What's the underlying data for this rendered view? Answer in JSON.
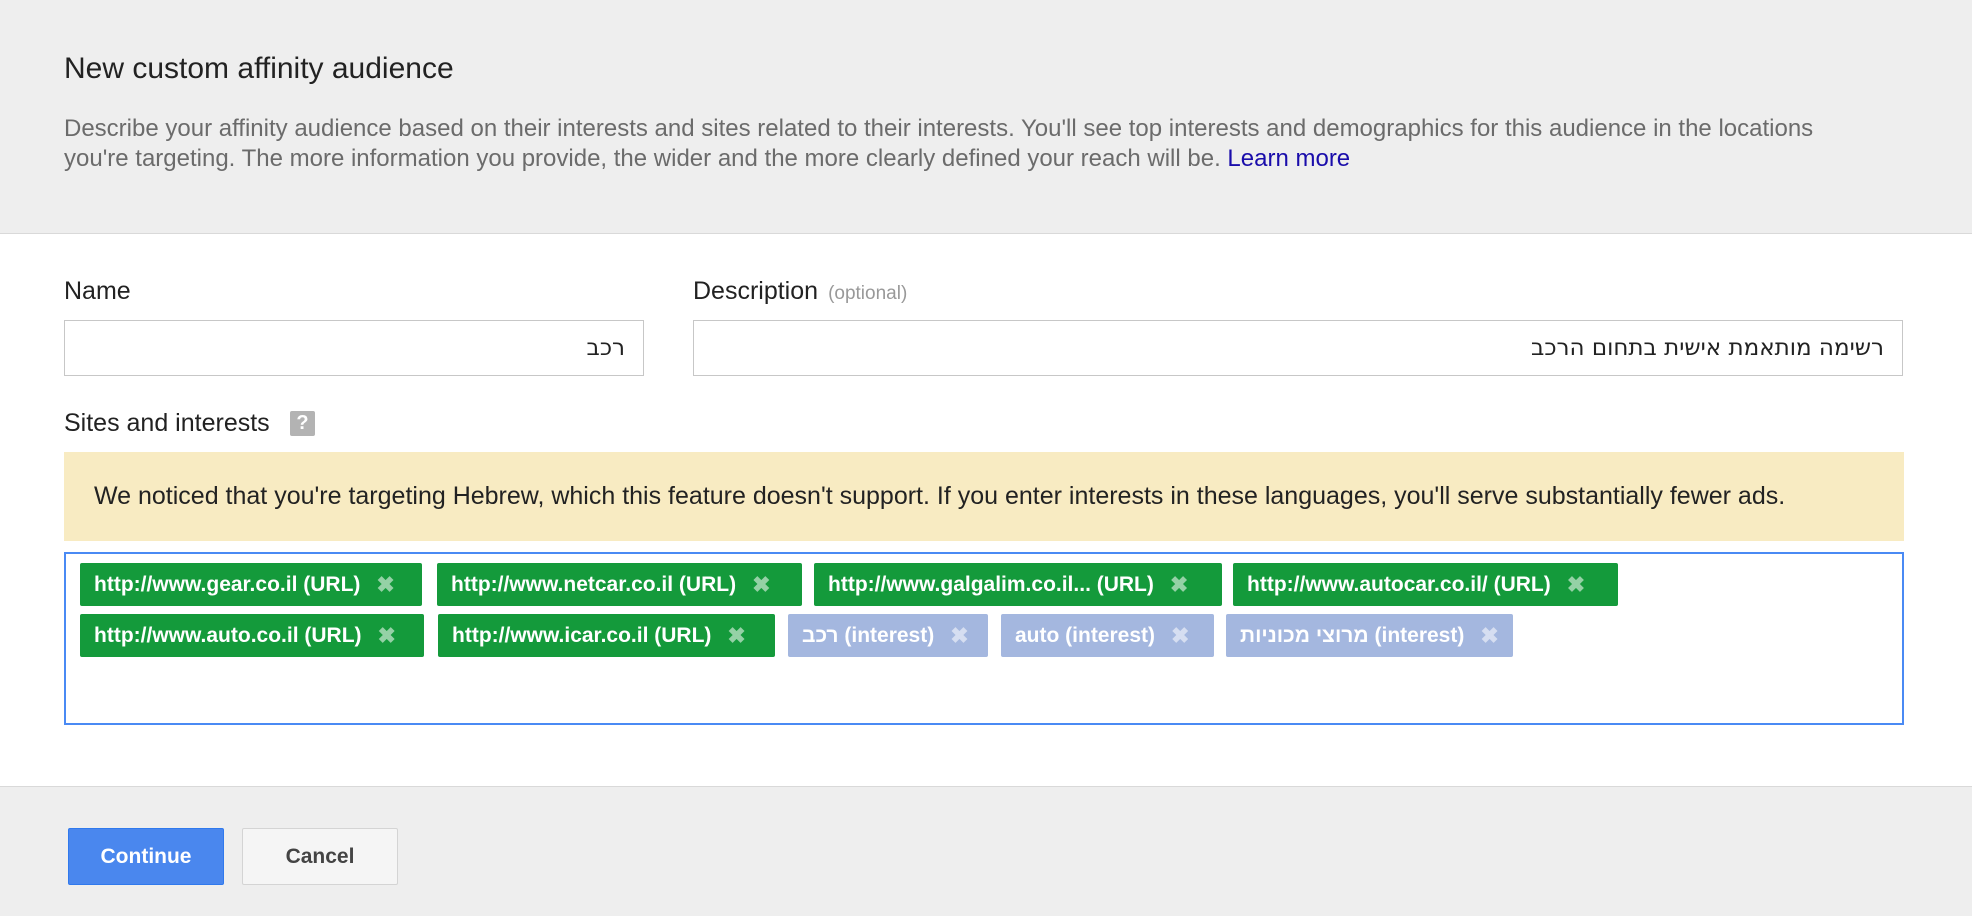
{
  "header": {
    "title": "New custom affinity audience",
    "description": "Describe your affinity audience based on their interests and sites related to their interests. You'll see top interests and demographics for this audience in the locations you're targeting. The more information you provide, the wider and the more clearly defined your reach will be.",
    "learn_more": "Learn more"
  },
  "form": {
    "name_label": "Name",
    "name_value": "רכב",
    "description_label": "Description",
    "description_optional": "(optional)",
    "description_value": "רשימה מותאמת אישית בתחום הרכב",
    "sites_label": "Sites and interests",
    "help_glyph": "?"
  },
  "warning": "We noticed that you're targeting Hebrew, which this feature doesn't support. If you enter interests in these languages, you'll serve substantially fewer ads.",
  "tags": [
    {
      "label": "http://www.gear.co.il (URL)",
      "kind": "url"
    },
    {
      "label": "http://www.netcar.co.il (URL)",
      "kind": "url"
    },
    {
      "label": "http://www.galgalim.co.il... (URL)",
      "kind": "url"
    },
    {
      "label": "http://www.autocar.co.il/ (URL)",
      "kind": "url"
    },
    {
      "label": "http://www.auto.co.il (URL)",
      "kind": "url"
    },
    {
      "label": "http://www.icar.co.il (URL)",
      "kind": "url"
    },
    {
      "label": "רכב (interest)",
      "kind": "interest"
    },
    {
      "label": "auto (interest)",
      "kind": "interest"
    },
    {
      "label": "מרוצי מכוניות (interest)",
      "kind": "interest"
    }
  ],
  "remove_glyph": "✖",
  "colors": {
    "url_tag": "#149a3b",
    "interest_tag": "#a4b7df",
    "primary_button": "#4a87ee",
    "warning_bg": "#f8ebc2",
    "link": "#1a0dab"
  },
  "footer": {
    "continue_label": "Continue",
    "cancel_label": "Cancel"
  }
}
